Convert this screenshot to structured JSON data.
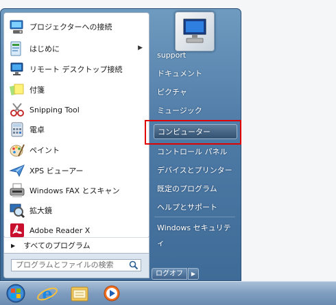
{
  "left_menu": {
    "items": [
      {
        "label": "プロジェクターへの接続",
        "icon": "projector-icon"
      },
      {
        "label": "はじめに",
        "icon": "getting-started-icon",
        "has_submenu": true
      },
      {
        "label": "リモート デスクトップ接続",
        "icon": "remote-desktop-icon"
      },
      {
        "label": "付箋",
        "icon": "sticky-notes-icon"
      },
      {
        "label": "Snipping Tool",
        "icon": "snipping-tool-icon"
      },
      {
        "label": "電卓",
        "icon": "calculator-icon"
      },
      {
        "label": "ペイント",
        "icon": "paint-icon"
      },
      {
        "label": "XPS ビューアー",
        "icon": "xps-viewer-icon"
      },
      {
        "label": "Windows FAX とスキャン",
        "icon": "fax-scan-icon"
      },
      {
        "label": "拡大鏡",
        "icon": "magnifier-icon"
      },
      {
        "label": "Adobe Reader X",
        "icon": "adobe-reader-icon"
      }
    ],
    "all_programs": "すべてのプログラム",
    "search_placeholder": "プログラムとファイルの検索"
  },
  "right_menu": {
    "items": [
      {
        "label": "support"
      },
      {
        "label": "ドキュメント"
      },
      {
        "label": "ピクチャ"
      },
      {
        "label": "ミュージック"
      },
      {
        "label": "コンピューター",
        "highlighted": true
      },
      {
        "label": "コントロール パネル"
      },
      {
        "label": "デバイスとプリンター"
      },
      {
        "label": "既定のプログラム"
      },
      {
        "label": "ヘルプとサポート"
      },
      {
        "label": "Windows セキュリティ"
      }
    ],
    "logoff_label": "ログオフ"
  },
  "taskbar": {
    "buttons": [
      "start-orb-icon",
      "internet-explorer-icon",
      "explorer-folder-icon",
      "media-player-icon"
    ]
  },
  "colors": {
    "highlight_border": "#e00000"
  }
}
